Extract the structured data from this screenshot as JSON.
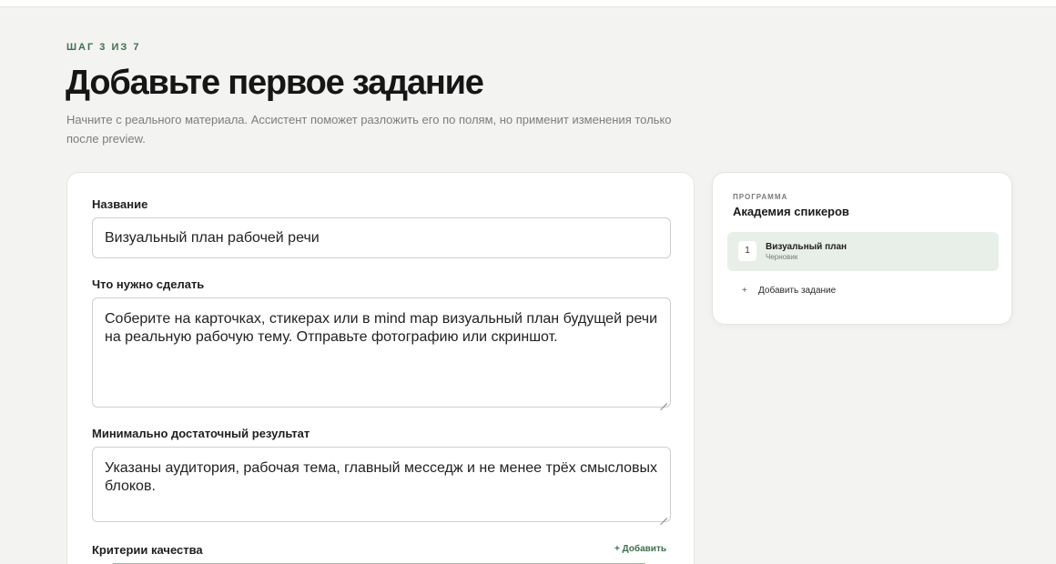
{
  "header": {
    "step": "ШАГ 3 ИЗ 7",
    "title": "Добавьте первое задание",
    "subtitle": "Начните с реального материала. Ассистент поможет разложить его по полям, но применит изменения только после preview."
  },
  "form": {
    "name_label": "Название",
    "name_value": "Визуальный план рабочей речи",
    "task_label": "Что нужно сделать",
    "task_value": "Соберите на карточках, стикерах или в mind map визуальный план будущей речи на реальную рабочую тему. Отправьте фотографию или скриншот.",
    "result_label": "Минимально достаточный результат",
    "result_value": "Указаны аудитория, рабочая тема, главный месседж и не менее трёх смысловых блоков.",
    "criteria_label": "Критерии качества",
    "criteria_add": "+ Добавить"
  },
  "sidebar": {
    "kicker": "ПРОГРАММА",
    "title": "Академия спикеров",
    "items": [
      {
        "number": "1",
        "name": "Визуальный план",
        "status": "Черновик"
      }
    ],
    "add_plus": "+",
    "add_label": "Добавить задание"
  },
  "colors": {
    "accent": "#3f6f4f",
    "background": "#f3f3f1",
    "active_item": "#e8eee8"
  }
}
